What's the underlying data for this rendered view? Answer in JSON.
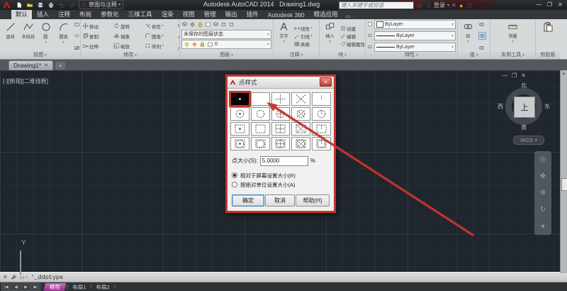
{
  "title_bar": {
    "app_name": "Autodesk AutoCAD 2014",
    "doc_name": "Drawing1.dwg",
    "workspace": "草图与注释",
    "search_placeholder": "键入关键字或短语",
    "sign_in": "登录",
    "qat_icons": [
      "new-file",
      "open-file",
      "save",
      "plot",
      "undo",
      "redo"
    ],
    "window_controls": [
      "minimize",
      "restore",
      "close"
    ]
  },
  "ribbon": {
    "active_tab": "默认",
    "tabs": [
      "默认",
      "插入",
      "注释",
      "布局",
      "参数化",
      "三维工具",
      "渲染",
      "视图",
      "管理",
      "输出",
      "插件",
      "Autodesk 360",
      "精选应用"
    ],
    "panels": {
      "draw": {
        "label": "绘图",
        "buttons": [
          {
            "label": "直线",
            "icon": "line"
          },
          {
            "label": "多段线",
            "icon": "polyline"
          },
          {
            "label": "圆",
            "icon": "circle",
            "flyout": true
          },
          {
            "label": "圆弧",
            "icon": "arc",
            "flyout": true
          }
        ],
        "side_icons": [
          "rect",
          "ellipse",
          "hatch"
        ]
      },
      "modify": {
        "label": "修改",
        "buttons": [
          {
            "label": "移动",
            "icon": "move"
          },
          {
            "label": "旋转",
            "icon": "rotate"
          },
          {
            "label": "修剪",
            "icon": "trim",
            "flyout": true
          },
          {
            "label": "复制",
            "icon": "copy"
          },
          {
            "label": "镜像",
            "icon": "mirror"
          },
          {
            "label": "圆角",
            "icon": "fillet",
            "flyout": true
          },
          {
            "label": "拉伸",
            "icon": "stretch"
          },
          {
            "label": "缩放",
            "icon": "scale"
          },
          {
            "label": "阵列",
            "icon": "array",
            "flyout": true
          }
        ],
        "side_icons": [
          "erase",
          "edit",
          "arc"
        ]
      },
      "layers": {
        "label": "图层",
        "tool_icons": [
          "layers",
          "gear",
          "lock",
          "swatch",
          "layers",
          "box",
          "box"
        ],
        "layer_state": "未保存的图层状态",
        "layer_row_icons": [
          "bulb",
          "sun",
          "lock",
          "swatch"
        ],
        "current_layer": "0"
      },
      "annotation": {
        "label": "注释",
        "big": {
          "label": "文字",
          "icon": "textA"
        },
        "rows": [
          {
            "label": "线性",
            "icon": "dim",
            "flyout": true
          },
          {
            "label": "引线",
            "icon": "leader",
            "flyout": true
          },
          {
            "label": "表格",
            "icon": "table"
          }
        ]
      },
      "block": {
        "label": "块",
        "big": {
          "label": "插入",
          "icon": "insert"
        },
        "rows": [
          {
            "label": "创建",
            "icon": "create"
          },
          {
            "label": "编辑",
            "icon": "edit"
          },
          {
            "label": "编辑属性",
            "icon": "attrs"
          }
        ]
      },
      "properties": {
        "label": "特性",
        "values": [
          "ByLayer",
          "ByLayer",
          "ByLayer"
        ]
      },
      "groups": {
        "label": "组",
        "big": {
          "label": "组",
          "icon": "group"
        }
      },
      "utilities": {
        "label": "实用工具",
        "big": {
          "label": "测量",
          "icon": "measure"
        }
      },
      "clipboard": {
        "label": "剪贴板",
        "big": {
          "icon": "paste"
        }
      }
    }
  },
  "file_tab": {
    "name": "Drawing1*",
    "close_icon": "close",
    "new_tab_icon": "plus"
  },
  "drawing_area": {
    "viewport_label": "[-][俯视][二维线框]",
    "window_controls": [
      "minimize",
      "restore",
      "close"
    ],
    "viewcube": {
      "north": "北",
      "south": "南",
      "west": "西",
      "east": "东",
      "top": "上",
      "wcs": "WCS"
    },
    "navbar_icons": [
      "full-nav-wheel",
      "pan",
      "zoom",
      "orbit",
      "showmotion"
    ],
    "ucs_y_label": "Y"
  },
  "dialog": {
    "title": "点样式",
    "point_styles": [
      {
        "mark": "dot",
        "circle": false,
        "square": false,
        "selected": true
      },
      {
        "mark": "none",
        "circle": false,
        "square": false
      },
      {
        "mark": "plus",
        "circle": false,
        "square": false
      },
      {
        "mark": "cross",
        "circle": false,
        "square": false
      },
      {
        "mark": "tick",
        "circle": false,
        "square": false
      },
      {
        "mark": "dot",
        "circle": true,
        "square": false
      },
      {
        "mark": "none",
        "circle": true,
        "square": false
      },
      {
        "mark": "plus",
        "circle": true,
        "square": false
      },
      {
        "mark": "cross",
        "circle": true,
        "square": false
      },
      {
        "mark": "tick",
        "circle": true,
        "square": false
      },
      {
        "mark": "dot",
        "circle": false,
        "square": true
      },
      {
        "mark": "none",
        "circle": false,
        "square": true
      },
      {
        "mark": "plus",
        "circle": false,
        "square": true
      },
      {
        "mark": "cross",
        "circle": false,
        "square": true
      },
      {
        "mark": "tick",
        "circle": false,
        "square": true
      },
      {
        "mark": "dot",
        "circle": true,
        "square": true
      },
      {
        "mark": "none",
        "circle": true,
        "square": true
      },
      {
        "mark": "plus",
        "circle": true,
        "square": true
      },
      {
        "mark": "cross",
        "circle": true,
        "square": true
      },
      {
        "mark": "tick",
        "circle": true,
        "square": true
      }
    ],
    "size_label": "点大小(S):",
    "size_value": "5.0000",
    "size_unit": "%",
    "radio_options": [
      "相对于屏幕设置大小(R)",
      "按绝对单位设置大小(A)"
    ],
    "radio_selected_index": 0,
    "ok": "确定",
    "cancel": "取消",
    "help": "帮助(H)"
  },
  "command_line": {
    "text": "'_ddptype"
  },
  "status_bar": {
    "nav_icons": [
      "first",
      "prev",
      "next",
      "last"
    ],
    "tabs": [
      "模型",
      "布局1",
      "布局2"
    ],
    "active_tab": "模型"
  },
  "colors": {
    "annotation_red": "#c5342c",
    "model_tab_magenta": "#b0529e",
    "canvas_bg": "#20262d",
    "ribbon_bg": "#d6d9da"
  }
}
